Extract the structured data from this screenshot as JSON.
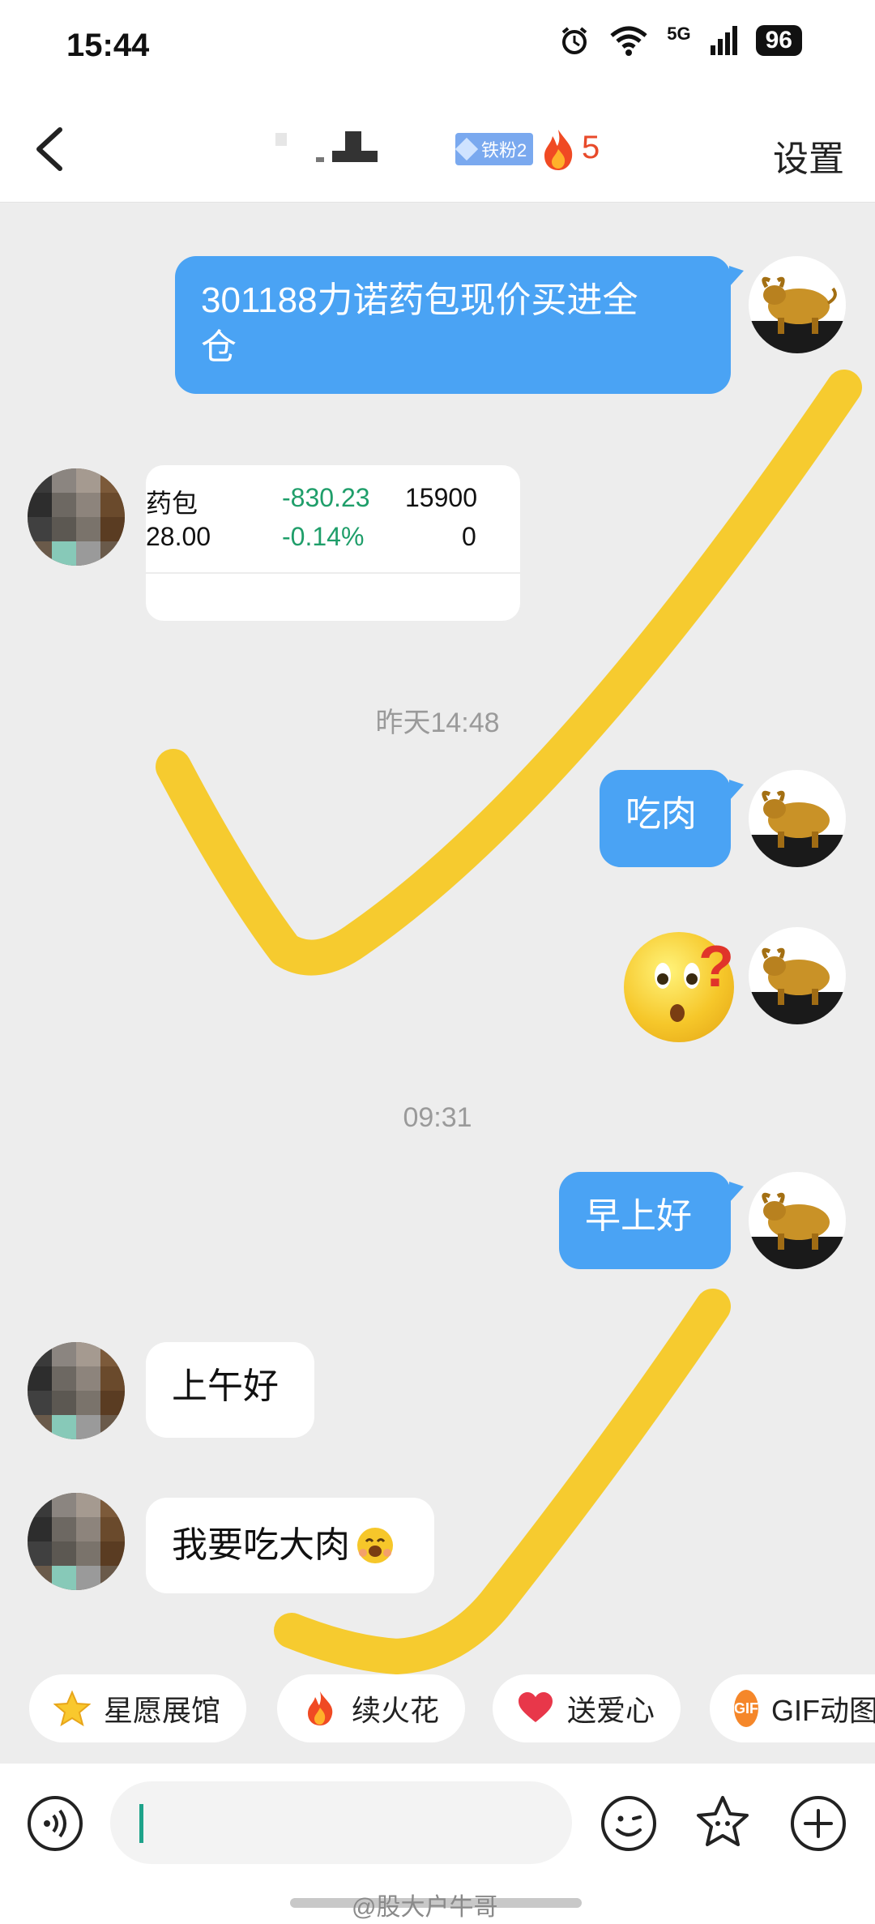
{
  "status_bar": {
    "time": "15:44",
    "network": "5G",
    "battery": "96"
  },
  "header": {
    "flame_count": "5",
    "badge_label": "铁粉2",
    "settings_label": "设置"
  },
  "chat": {
    "messages": [
      {
        "sender": "me",
        "text": "301188力诺药包现价买进全仓"
      },
      {
        "sender": "other",
        "type": "stock-screenshot"
      },
      {
        "sender": "me",
        "text": "吃肉"
      },
      {
        "sender": "me",
        "type": "emoji",
        "emoji_name": "surprised-face-with-question-mark"
      },
      {
        "sender": "me",
        "text": "早上好"
      },
      {
        "sender": "other",
        "text": "上午好"
      },
      {
        "sender": "other",
        "text": "我要吃大肉"
      }
    ],
    "timestamps": [
      "昨天14:48",
      "09:31"
    ],
    "stock_card": {
      "name_fragment": "药包",
      "price_fragment": "28.00",
      "change_amount": "-830.23",
      "change_percent": "-0.14%",
      "volume": "15900",
      "volume_2": "0"
    },
    "msg1_line1": "301188力诺药包现价买进全",
    "msg1_line2": "仓",
    "msg2": "吃肉",
    "msg3": "早上好",
    "msg4": "上午好",
    "msg5": "我要吃大肉"
  },
  "quick_actions": [
    {
      "label": "星愿展馆",
      "icon": "star-icon"
    },
    {
      "label": "续火花",
      "icon": "flame-icon"
    },
    {
      "label": "送爱心",
      "icon": "heart-icon"
    },
    {
      "label": "GIF动图",
      "icon": "gif-icon"
    }
  ],
  "qa_labels": {
    "a": "星愿展馆",
    "b": "续火花",
    "c": "送爱心",
    "d": "GIF动图",
    "gif_badge": "GIF"
  },
  "input_bar": {
    "voice_icon": "voice-icon",
    "emoji_icon": "emoji-icon",
    "sticker_icon": "star-sticker-icon",
    "plus_icon": "plus-icon"
  },
  "watermark": "@股大户牛哥",
  "colors": {
    "my_bubble": "#4aa3f4",
    "other_bubble": "#ffffff",
    "background": "#ededed",
    "checkmark": "#f6c61a",
    "stock_green": "#1f9e6a"
  }
}
